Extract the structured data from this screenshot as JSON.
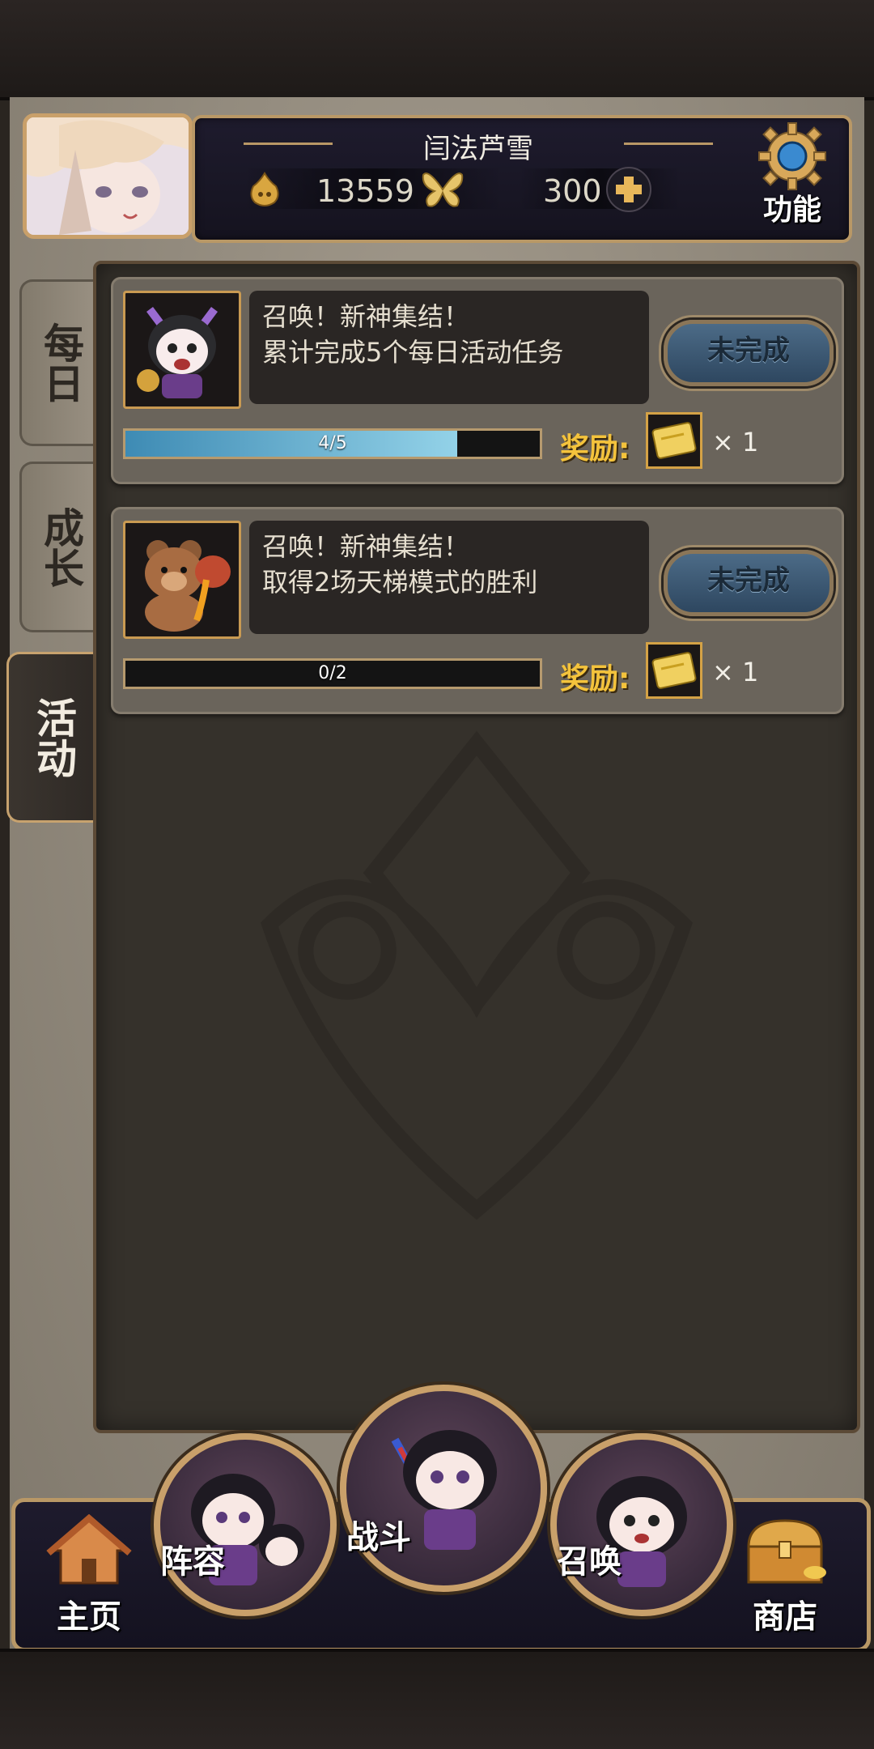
{
  "header": {
    "player_name": "闫法芦雪",
    "gold": "13559",
    "gems": "300",
    "function_label": "功能"
  },
  "tabs": [
    {
      "label": "每日",
      "active": false
    },
    {
      "label": "成长",
      "active": false
    },
    {
      "label": "活动",
      "active": true
    }
  ],
  "tasks": [
    {
      "title": "召唤！新神集结！",
      "description": "累计完成5个每日活动任务",
      "status": "未完成",
      "progress_text": "4/5",
      "progress": 0.8,
      "reward_label": "奖励:",
      "reward_qty": "× 1"
    },
    {
      "title": "召唤！新神集结！",
      "description": "取得2场天梯模式的胜利",
      "status": "未完成",
      "progress_text": "0/2",
      "progress": 0.0,
      "reward_label": "奖励:",
      "reward_qty": "× 1"
    }
  ],
  "nav": {
    "home": "主页",
    "team": "阵容",
    "battle": "战斗",
    "summon": "召唤",
    "shop": "商店"
  },
  "colors": {
    "accent_gold": "#c9a06a",
    "reward_gold": "#f4c33c",
    "progress_blue": "#3e8bb4"
  },
  "icons": [
    "gold-coin-icon",
    "butterfly-icon",
    "add-icon",
    "gear-icon",
    "ticket-icon",
    "home-icon",
    "treasure-chest-icon"
  ]
}
